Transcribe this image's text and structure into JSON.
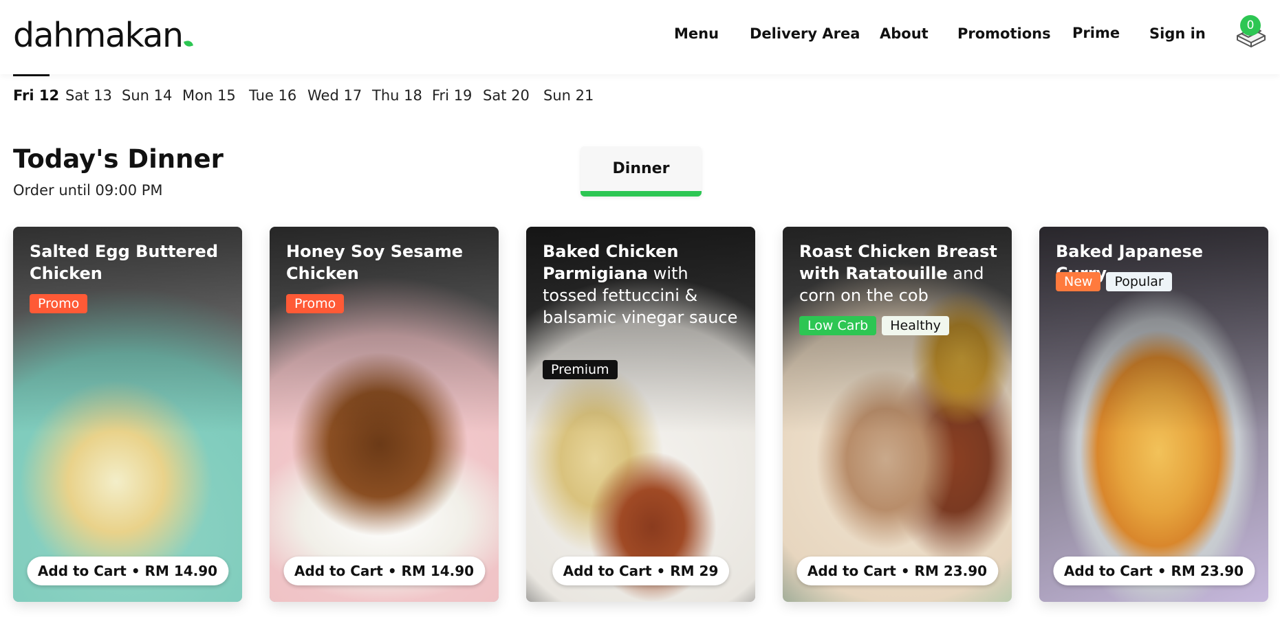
{
  "brand": {
    "name": "dahmakan",
    "accent": "#2dc653"
  },
  "nav": {
    "menu": "Menu",
    "delivery_area": "Delivery Area",
    "about": "About",
    "promotions": "Promotions",
    "prime": "Prime",
    "sign_in": "Sign in"
  },
  "cart": {
    "count": "0",
    "icon": "box-icon"
  },
  "dates": [
    "Fri 12",
    "Sat 13",
    "Sun 14",
    "Mon 15",
    "Tue 16",
    "Wed 17",
    "Thu 18",
    "Fri 19",
    "Sat 20",
    "Sun 21"
  ],
  "selected_date": "Fri 12",
  "section": {
    "title": "Today's Dinner",
    "subtitle": "Order until 09:00 PM"
  },
  "meal_tab": {
    "label": "Dinner"
  },
  "cards": [
    {
      "title_bold": "Salted Egg Buttered Chicken",
      "title_rest": "",
      "tags": [
        "Promo"
      ],
      "button": "Add to Cart • RM 14.90"
    },
    {
      "title_bold": "Honey Soy Sesame Chicken",
      "title_rest": "",
      "tags": [
        "Promo"
      ],
      "button": "Add to Cart • RM 14.90"
    },
    {
      "title_bold": "Baked Chicken Parmigiana",
      "title_rest": " with tossed fettuccini & balsamic vinegar sauce",
      "tags": [
        "Premium"
      ],
      "button": "Add to Cart • RM 29"
    },
    {
      "title_bold": "Roast Chicken Breast with Ratatouille",
      "title_rest": " and corn on the cob",
      "tags": [
        "Low Carb",
        "Healthy"
      ],
      "button": "Add to Cart • RM 23.90"
    },
    {
      "title_bold": "Baked Japanese Curry",
      "title_rest": "",
      "tags": [
        "New",
        "Popular"
      ],
      "button": "Add to Cart • RM 23.90"
    }
  ]
}
